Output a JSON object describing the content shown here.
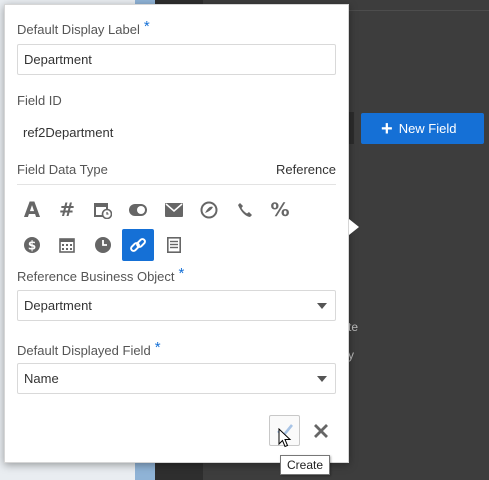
{
  "background": {
    "new_field_label": "New Field",
    "snippet_1": "te",
    "snippet_2": "y"
  },
  "popover": {
    "display_label": {
      "label": "Default Display Label",
      "required": "*",
      "value": "Department"
    },
    "field_id": {
      "label": "Field ID",
      "value": "ref2Department"
    },
    "field_data_type": {
      "label": "Field Data Type",
      "value": "Reference"
    },
    "type_icons": [
      {
        "name": "text-icon",
        "selected": false
      },
      {
        "name": "number-icon",
        "selected": false
      },
      {
        "name": "date-time-icon",
        "selected": false
      },
      {
        "name": "boolean-toggle-icon",
        "selected": false
      },
      {
        "name": "email-icon",
        "selected": false
      },
      {
        "name": "url-icon",
        "selected": false
      },
      {
        "name": "phone-icon",
        "selected": false
      },
      {
        "name": "percentage-icon",
        "selected": false
      },
      {
        "name": "currency-icon",
        "selected": false
      },
      {
        "name": "date-icon",
        "selected": false
      },
      {
        "name": "time-icon",
        "selected": false
      },
      {
        "name": "reference-link-icon",
        "selected": true
      },
      {
        "name": "long-text-icon",
        "selected": false
      }
    ],
    "reference_object": {
      "label": "Reference Business Object",
      "required": "*",
      "value": "Department"
    },
    "displayed_field": {
      "label": "Default Displayed Field",
      "required": "*",
      "value": "Name"
    },
    "tooltip": "Create"
  },
  "colors": {
    "accent": "#1570d6",
    "popover_bg": "#ffffff",
    "app_bg": "#3d3d3d"
  }
}
